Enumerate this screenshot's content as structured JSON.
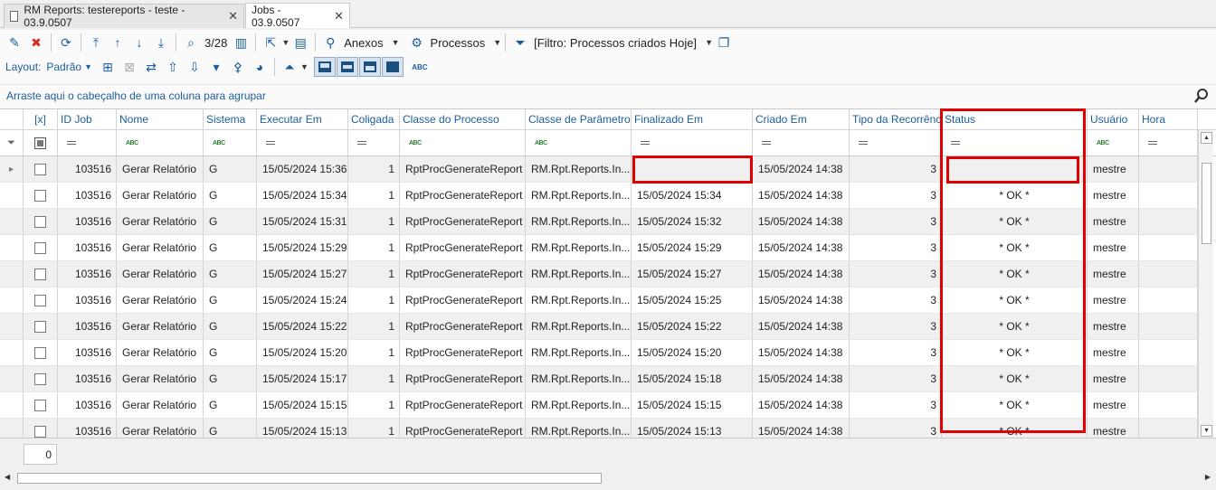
{
  "tabs": [
    {
      "label": "RM Reports: testereports - teste - 03.9.0507",
      "active": false
    },
    {
      "label": "Jobs - 03.9.0507",
      "active": true
    }
  ],
  "toolbar": {
    "record_position": "3/28",
    "anexos_label": "Anexos",
    "processos_label": "Processos",
    "filter_label": "[Filtro: Processos criados Hoje]",
    "layout_label": "Layout:",
    "layout_value": "Padrão"
  },
  "groupbar": {
    "hint": "Arraste aqui o cabeçalho de uma coluna para agrupar"
  },
  "grid": {
    "select_header": "[x]",
    "columns": [
      "ID Job",
      "Nome",
      "Sistema",
      "Executar Em",
      "Coligada",
      "Classe do Processo",
      "Classe de Parâmetros",
      "Finalizado Em",
      "Criado Em",
      "Tipo da Recorrência",
      "Status",
      "Usuário",
      "Hora"
    ],
    "abc_label": "ABC",
    "rows": [
      {
        "id": "103516",
        "nome": "Gerar Relatório",
        "sistema": "G",
        "executar": "15/05/2024 15:36",
        "coligada": "1",
        "classe": "RptProcGenerateReport",
        "params": "RM.Rpt.Reports.In...",
        "finalizado": "",
        "criado": "15/05/2024 14:38",
        "tipo": "3",
        "status": "",
        "usuario": "mestre"
      },
      {
        "id": "103516",
        "nome": "Gerar Relatório",
        "sistema": "G",
        "executar": "15/05/2024 15:34",
        "coligada": "1",
        "classe": "RptProcGenerateReport",
        "params": "RM.Rpt.Reports.In...",
        "finalizado": "15/05/2024 15:34",
        "criado": "15/05/2024 14:38",
        "tipo": "3",
        "status": "* OK *",
        "usuario": "mestre"
      },
      {
        "id": "103516",
        "nome": "Gerar Relatório",
        "sistema": "G",
        "executar": "15/05/2024 15:31",
        "coligada": "1",
        "classe": "RptProcGenerateReport",
        "params": "RM.Rpt.Reports.In...",
        "finalizado": "15/05/2024 15:32",
        "criado": "15/05/2024 14:38",
        "tipo": "3",
        "status": "* OK *",
        "usuario": "mestre"
      },
      {
        "id": "103516",
        "nome": "Gerar Relatório",
        "sistema": "G",
        "executar": "15/05/2024 15:29",
        "coligada": "1",
        "classe": "RptProcGenerateReport",
        "params": "RM.Rpt.Reports.In...",
        "finalizado": "15/05/2024 15:29",
        "criado": "15/05/2024 14:38",
        "tipo": "3",
        "status": "* OK *",
        "usuario": "mestre"
      },
      {
        "id": "103516",
        "nome": "Gerar Relatório",
        "sistema": "G",
        "executar": "15/05/2024 15:27",
        "coligada": "1",
        "classe": "RptProcGenerateReport",
        "params": "RM.Rpt.Reports.In...",
        "finalizado": "15/05/2024 15:27",
        "criado": "15/05/2024 14:38",
        "tipo": "3",
        "status": "* OK *",
        "usuario": "mestre"
      },
      {
        "id": "103516",
        "nome": "Gerar Relatório",
        "sistema": "G",
        "executar": "15/05/2024 15:24",
        "coligada": "1",
        "classe": "RptProcGenerateReport",
        "params": "RM.Rpt.Reports.In...",
        "finalizado": "15/05/2024 15:25",
        "criado": "15/05/2024 14:38",
        "tipo": "3",
        "status": "* OK *",
        "usuario": "mestre"
      },
      {
        "id": "103516",
        "nome": "Gerar Relatório",
        "sistema": "G",
        "executar": "15/05/2024 15:22",
        "coligada": "1",
        "classe": "RptProcGenerateReport",
        "params": "RM.Rpt.Reports.In...",
        "finalizado": "15/05/2024 15:22",
        "criado": "15/05/2024 14:38",
        "tipo": "3",
        "status": "* OK *",
        "usuario": "mestre"
      },
      {
        "id": "103516",
        "nome": "Gerar Relatório",
        "sistema": "G",
        "executar": "15/05/2024 15:20",
        "coligada": "1",
        "classe": "RptProcGenerateReport",
        "params": "RM.Rpt.Reports.In...",
        "finalizado": "15/05/2024 15:20",
        "criado": "15/05/2024 14:38",
        "tipo": "3",
        "status": "* OK *",
        "usuario": "mestre"
      },
      {
        "id": "103516",
        "nome": "Gerar Relatório",
        "sistema": "G",
        "executar": "15/05/2024 15:17",
        "coligada": "1",
        "classe": "RptProcGenerateReport",
        "params": "RM.Rpt.Reports.In...",
        "finalizado": "15/05/2024 15:18",
        "criado": "15/05/2024 14:38",
        "tipo": "3",
        "status": "* OK *",
        "usuario": "mestre"
      },
      {
        "id": "103516",
        "nome": "Gerar Relatório",
        "sistema": "G",
        "executar": "15/05/2024 15:15",
        "coligada": "1",
        "classe": "RptProcGenerateReport",
        "params": "RM.Rpt.Reports.In...",
        "finalizado": "15/05/2024 15:15",
        "criado": "15/05/2024 14:38",
        "tipo": "3",
        "status": "* OK *",
        "usuario": "mestre"
      },
      {
        "id": "103516",
        "nome": "Gerar Relatório",
        "sistema": "G",
        "executar": "15/05/2024 15:13",
        "coligada": "1",
        "classe": "RptProcGenerateReport",
        "params": "RM.Rpt.Reports.In...",
        "finalizado": "15/05/2024 15:13",
        "criado": "15/05/2024 14:38",
        "tipo": "3",
        "status": "* OK *",
        "usuario": "mestre"
      }
    ]
  },
  "footer": {
    "count": "0"
  },
  "colors": {
    "accent": "#1b5e9e",
    "highlight": "#e00000",
    "alt_row": "#f0f0f0"
  }
}
